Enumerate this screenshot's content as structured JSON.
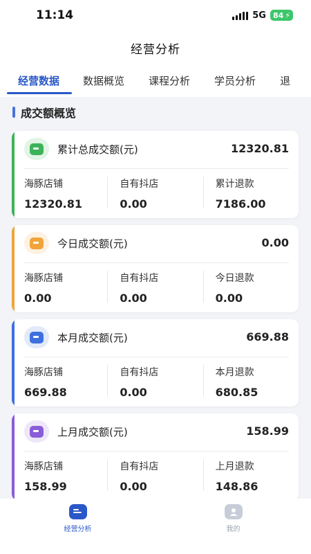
{
  "status": {
    "time": "11:14",
    "network": "5G",
    "battery": "84"
  },
  "nav": {
    "title": "经营分析"
  },
  "tabs": [
    "经营数据",
    "数据概览",
    "课程分析",
    "学员分析",
    "退"
  ],
  "section": {
    "title": "成交额概览"
  },
  "cards": [
    {
      "label": "累计总成交额(元)",
      "total": "12320.81",
      "accent": "#3cb35a",
      "icon": "wallet-icon",
      "cells": [
        {
          "label": "海豚店铺",
          "value": "12320.81"
        },
        {
          "label": "自有抖店",
          "value": "0.00"
        },
        {
          "label": "累计退款",
          "value": "7186.00"
        }
      ]
    },
    {
      "label": "今日成交额(元)",
      "total": "0.00",
      "accent": "#f0a43a",
      "icon": "coins-icon",
      "cells": [
        {
          "label": "海豚店铺",
          "value": "0.00"
        },
        {
          "label": "自有抖店",
          "value": "0.00"
        },
        {
          "label": "今日退款",
          "value": "0.00"
        }
      ]
    },
    {
      "label": "本月成交额(元)",
      "total": "669.88",
      "accent": "#3d6fe0",
      "icon": "card-icon",
      "cells": [
        {
          "label": "海豚店铺",
          "value": "669.88"
        },
        {
          "label": "自有抖店",
          "value": "0.00"
        },
        {
          "label": "本月退款",
          "value": "680.85"
        }
      ]
    },
    {
      "label": "上月成交额(元)",
      "total": "158.99",
      "accent": "#8a5cd8",
      "icon": "card-icon",
      "cells": [
        {
          "label": "海豚店铺",
          "value": "158.99"
        },
        {
          "label": "自有抖店",
          "value": "0.00"
        },
        {
          "label": "上月退款",
          "value": "148.86"
        }
      ]
    }
  ],
  "bottom_nav": [
    {
      "label": "经营分析",
      "icon": "analysis-icon",
      "active": true,
      "color": "#2a58c8"
    },
    {
      "label": "我的",
      "icon": "profile-icon",
      "active": false,
      "color": "#9aa3b2"
    }
  ]
}
